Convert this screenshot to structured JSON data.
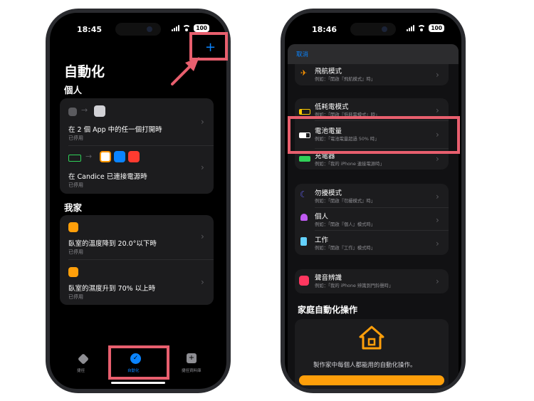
{
  "left_phone": {
    "status": {
      "time": "18:45",
      "battery": "100"
    },
    "add_label": "+",
    "title": "自動化",
    "sections": [
      {
        "header": "個人",
        "items": [
          {
            "title": "在 2 個 App 中的任一個打開時",
            "subtitle": "已停用"
          },
          {
            "title": "在 Candice 已連接電源時",
            "subtitle": "已停用"
          }
        ]
      },
      {
        "header": "我家",
        "items": [
          {
            "title": "臥室的溫度降到 20.0°以下時",
            "subtitle": "已停用"
          },
          {
            "title": "臥室的濕度升到 70% 以上時",
            "subtitle": "已停用"
          }
        ]
      }
    ],
    "tabs": [
      {
        "label": "捷徑",
        "icon": "layers-icon"
      },
      {
        "label": "自動化",
        "icon": "automation-check-icon"
      },
      {
        "label": "捷徑資料庫",
        "icon": "gallery-plus-icon"
      }
    ]
  },
  "right_phone": {
    "status": {
      "time": "18:46",
      "battery": "100"
    },
    "cancel_label": "取消",
    "groups": [
      {
        "items": [
          {
            "title": "飛航模式",
            "subtitle": "例如：「開啟『飛航模式』時」",
            "icon": "airplane-icon",
            "color": "#ff9500"
          }
        ]
      },
      {
        "items": [
          {
            "title": "低耗電模式",
            "subtitle": "例如：「開啟『低耗電模式』時」",
            "icon": "low-battery-icon",
            "color": "#ffcc00"
          },
          {
            "title": "電池電量",
            "subtitle": "例如：「電池電量超過 50% 時」",
            "icon": "battery-icon",
            "color": "#ffffff"
          },
          {
            "title": "充電器",
            "subtitle": "例如：「我的 iPhone 連接電源時」",
            "icon": "charging-icon",
            "color": "#30d158"
          }
        ]
      },
      {
        "items": [
          {
            "title": "勿擾模式",
            "subtitle": "例如：「開啟『勿擾模式』時」",
            "icon": "moon-icon",
            "color": "#5e5ce6"
          },
          {
            "title": "個人",
            "subtitle": "例如：「開啟『個人』模式時」",
            "icon": "person-icon",
            "color": "#bf5af2"
          },
          {
            "title": "工作",
            "subtitle": "例如：「開啟『工作』模式時」",
            "icon": "badge-icon",
            "color": "#64d2ff"
          }
        ]
      },
      {
        "items": [
          {
            "title": "聲音辨識",
            "subtitle": "例如：「我的 iPhone 辨識到門鈴聲時」",
            "icon": "sound-recognition-icon",
            "color": "#ff375f"
          }
        ]
      }
    ],
    "home_header": "家庭自動化操作",
    "home_caption": "製作家中每個人都能用的自動化操作。"
  },
  "colors": {
    "accent": "#0a84ff",
    "highlight": "#e85f6e",
    "card": "#1c1c1e",
    "home_orange": "#ff9f0a"
  }
}
